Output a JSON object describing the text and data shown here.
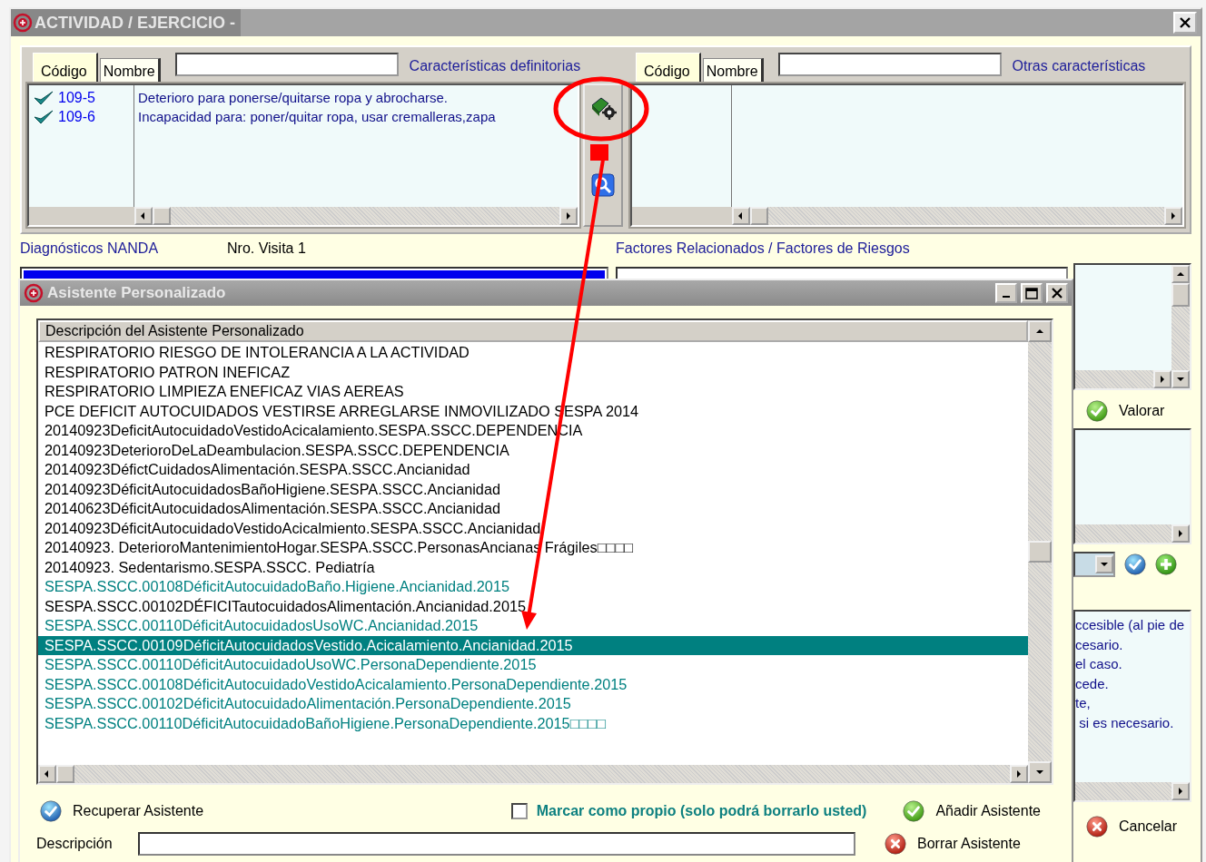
{
  "window": {
    "title": "ACTIVIDAD / EJERCICIO -"
  },
  "characteristic_panels": [
    {
      "tabs": [
        {
          "label": "Código",
          "selected": true
        },
        {
          "label": "Nombre",
          "selected": false
        }
      ],
      "title": "Características definitorias",
      "rows": [
        {
          "code": "109-5",
          "description": "Deterioro para ponerse/quitarse ropa y  abrocharse.",
          "checked": true
        },
        {
          "code": "109-6",
          "description": "Incapacidad para: poner/quitar ropa, usar cremalleras,zapa",
          "checked": true
        }
      ]
    },
    {
      "tabs": [
        {
          "label": "Código",
          "selected": true
        },
        {
          "label": "Nombre",
          "selected": false
        }
      ],
      "title": "Otras características"
    }
  ],
  "section_labels": {
    "diagnoses": "Diagnósticos NANDA",
    "visit": "Nro. Visita 1",
    "factors": "Factores Relacionados / Factores de Riesgos"
  },
  "side_panel": {
    "assess_button": "Valorar",
    "text_lines": [
      "ccesible (al pie de",
      "cesario.",
      "el caso.",
      "cede.",
      "te,",
      " si es necesario."
    ],
    "cancel_button": "Cancelar"
  },
  "dialog": {
    "title": "Asistente Personalizado",
    "column": "Descripción del Asistente Personalizado",
    "rows": [
      {
        "text": "RESPIRATORIO RIESGO DE INTOLERANCIA A LA ACTIVIDAD",
        "color": "#000000",
        "selected": false
      },
      {
        "text": "RESPIRATORIO PATRON INEFICAZ",
        "color": "#000000",
        "selected": false
      },
      {
        "text": "RESPIRATORIO LIMPIEZA ENEFICAZ VIAS AEREAS",
        "color": "#000000",
        "selected": false
      },
      {
        "text": "PCE DEFICIT AUTOCUIDADOS VESTIRSE ARREGLARSE INMOVILIZADO SESPA 2014",
        "color": "#000000",
        "selected": false
      },
      {
        "text": "20140923DeficitAutocuidadoVestidoAcicalamiento.SESPA.SSCC.DEPENDENCIA",
        "color": "#000000",
        "selected": false
      },
      {
        "text": "20140923DeterioroDeLaDeambulacion.SESPA.SSCC.DEPENDENCIA",
        "color": "#000000",
        "selected": false
      },
      {
        "text": "20140923DéfictCuidadosAlimentación.SESPA.SSCC.Ancianidad",
        "color": "#000000",
        "selected": false
      },
      {
        "text": "20140923DéficitAutocuidadosBañoHigiene.SESPA.SSCC.Ancianidad",
        "color": "#000000",
        "selected": false
      },
      {
        "text": "20140623DéficitAutocuidadosAlimentación.SESPA.SSCC.Ancianidad",
        "color": "#000000",
        "selected": false
      },
      {
        "text": "20140923DéficitAutocuidadoVestidoAcicalmiento.SESPA.SSCC.Ancianidad",
        "color": "#000000",
        "selected": false
      },
      {
        "text": "20140923. DeterioroMantenimientoHogar.SESPA.SSCC.PersonasAncianas Frágiles□□□□",
        "color": "#000000",
        "selected": false
      },
      {
        "text": "20140923. Sedentarismo.SESPA.SSCC. Pediatría",
        "color": "#000000",
        "selected": false
      },
      {
        "text": "SESPA.SSCC.00108DéficitAutocuidadoBaño.Higiene.Ancianidad.2015",
        "color": "#008080",
        "selected": false
      },
      {
        "text": "SESPA.SSCC.00102DÉFICITautocuidadosAlimentación.Ancianidad.2015",
        "color": "#000000",
        "selected": false
      },
      {
        "text": "SESPA.SSCC.00110DéficitAutocuidadosUsoWC.Ancianidad.2015",
        "color": "#008080",
        "selected": false
      },
      {
        "text": "SESPA.SSCC.00109DéficitAutocuidadosVestido.Acicalamiento.Ancianidad.2015",
        "color": "#008080",
        "selected": true
      },
      {
        "text": "SESPA.SSCC.00110DéficitAutocuidadoUsoWC.PersonaDependiente.2015",
        "color": "#008080",
        "selected": false
      },
      {
        "text": "SESPA.SSCC.00108DéficitAutocuidadoVestidoAcicalamiento.PersonaDependiente.2015",
        "color": "#008080",
        "selected": false
      },
      {
        "text": "SESPA.SSCC.00102DéficitAutocuidadoAlimentación.PersonaDependiente.2015",
        "color": "#008080",
        "selected": false
      },
      {
        "text": "SESPA.SSCC.00110DéficitAutocuidadoBañoHigiene.PersonaDependiente.2015□□□□",
        "color": "#008080",
        "selected": false
      }
    ],
    "recover_button": "Recuperar Asistente",
    "own_checkbox": {
      "label": "Marcar como propio (solo podrá borrarlo usted)",
      "checked": false
    },
    "add_button": "Añadir Asistente",
    "description_label": "Descripción",
    "delete_button": "Borrar Asistente"
  }
}
